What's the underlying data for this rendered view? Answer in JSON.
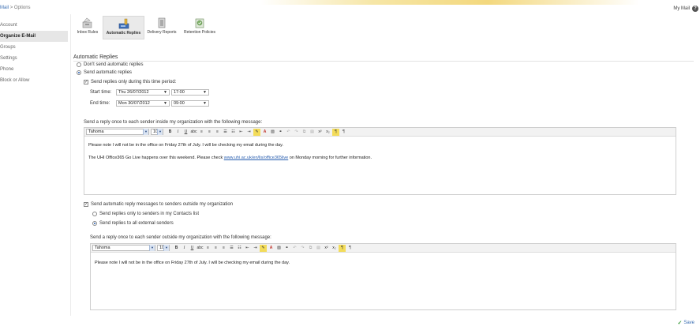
{
  "header": {
    "breadcrumb_home": "Mail",
    "breadcrumb_sep": ">",
    "breadcrumb_current": "Options",
    "my_mail": "My Mail",
    "help_glyph": "?"
  },
  "sidebar": {
    "items": [
      {
        "label": "Account"
      },
      {
        "label": "Organize E-Mail"
      },
      {
        "label": "Groups"
      },
      {
        "label": "Settings"
      },
      {
        "label": "Phone"
      },
      {
        "label": "Block or Allow"
      }
    ]
  },
  "toolbar": {
    "inbox_rules": "Inbox Rules",
    "automatic_replies": "Automatic Replies",
    "delivery_reports": "Delivery Reports",
    "retention_policies": "Retention Policies"
  },
  "main": {
    "heading": "Automatic Replies",
    "dont_send": "Don't send automatic replies",
    "send_auto": "Send automatic replies",
    "time_period": "Send replies only during this time period:",
    "start_label": "Start time:",
    "start_date": "Thu 26/07/2012",
    "start_time": "17:00",
    "end_label": "End time:",
    "end_date": "Mon 30/07/2012",
    "end_time": "09:00",
    "inside_label": "Send a reply once to each sender inside my organization with the following message:",
    "outside_check": "Send automatic reply messages to senders outside my organization",
    "contacts_only": "Send replies only to senders in my Contacts list",
    "all_external": "Send replies to all external senders",
    "outside_label": "Send a reply once to each sender outside my organization with the following message:"
  },
  "editor_inside": {
    "font": "Tahoma",
    "size": "10",
    "line1": "Please note I will not be in the office on Friday 27th of July. I will be checking my email during the day.",
    "line2_pre": "The UHI Office365 Go Live happens over this weekend. Please check ",
    "line2_link": "www.uhi.ac.uk/en/lis/office365live",
    "line2_post": " on Monday morning for further information."
  },
  "editor_outside": {
    "font": "Tahoma",
    "size": "10",
    "line1": "Please note I will not be in the office on Friday 27th of July. I will be checking my email during the day."
  },
  "footer": {
    "save": "Save"
  },
  "colors": {
    "accent": "#3b6fb3",
    "highlight": "#f3dc5a"
  }
}
